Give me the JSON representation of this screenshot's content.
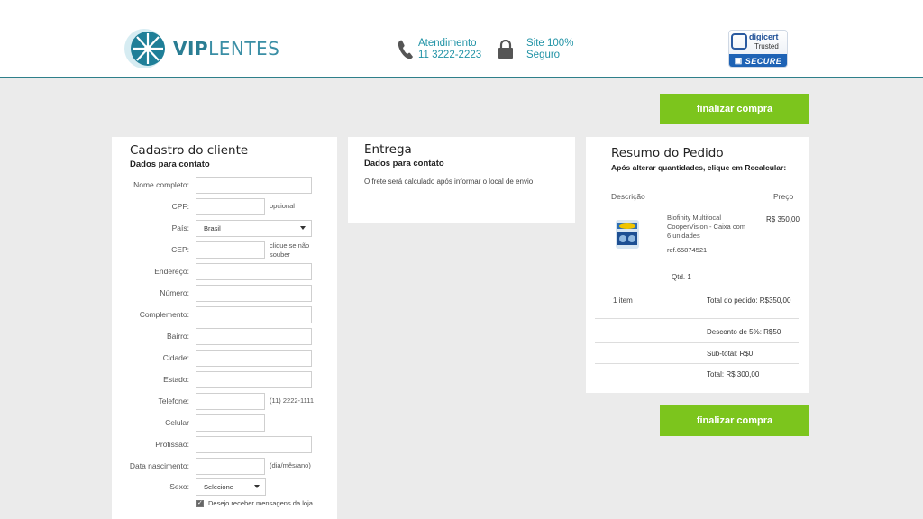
{
  "header": {
    "logo": {
      "vip": "VIP",
      "lentes": "LENTES"
    },
    "contact": {
      "label": "Atendimento",
      "phone": "11 3222-2223",
      "icon": "phone-icon"
    },
    "secure": {
      "line1": "Site 100%",
      "line2": "Seguro",
      "icon": "lock-icon"
    },
    "digicert": {
      "brand": "digicert",
      "trusted": "Trusted",
      "secure": "SECURE"
    }
  },
  "buttons": {
    "finalizar_top": "finalizar compra",
    "finalizar_bottom": "finalizar compra"
  },
  "cadastro": {
    "title": "Cadastro do cliente",
    "subtitle": "Dados para contato",
    "fields": [
      {
        "label": "Nome completo:",
        "value": "",
        "hint": ""
      },
      {
        "label": "CPF:",
        "value": "",
        "hint": "opcional"
      },
      {
        "label": "País:",
        "value": "Brasil",
        "hint": ""
      },
      {
        "label": "CEP:",
        "value": "",
        "hint": "clique se não souber"
      },
      {
        "label": "Endereço:",
        "value": "",
        "hint": ""
      },
      {
        "label": "Número:",
        "value": "",
        "hint": ""
      },
      {
        "label": "Complemento:",
        "value": "",
        "hint": ""
      },
      {
        "label": "Bairro:",
        "value": "",
        "hint": ""
      },
      {
        "label": "Cidade:",
        "value": "",
        "hint": ""
      },
      {
        "label": "Estado:",
        "value": "",
        "hint": ""
      },
      {
        "label": "Telefone:",
        "value": "",
        "hint": "(11) 2222-1111"
      },
      {
        "label": "Celular",
        "value": "",
        "hint": ""
      },
      {
        "label": "Profissão:",
        "value": "",
        "hint": ""
      },
      {
        "label": "Data nascimento:",
        "value": "",
        "hint": "(dia/mês/ano)"
      },
      {
        "label": "Sexo:",
        "value": "Selecione",
        "hint": ""
      }
    ],
    "checkbox_label": "Desejo receber mensagens da loja",
    "checkbox_checked": true
  },
  "entrega": {
    "title": "Entrega",
    "subtitle": "Dados para contato",
    "note": "O frete será calculado após informar o local de envio"
  },
  "resumo": {
    "title": "Resumo do Pedido",
    "subtitle": "Após alterar quantidades, clique em Recalcular:",
    "col_descricao": "Descrição",
    "col_preco": "Preço",
    "product": {
      "name": "Biofinity Multifocal CooperVision - Caixa com 6 unidades",
      "ref": "ref.65874521",
      "price": "R$ 350,00",
      "qty": "Qtd. 1"
    },
    "item_count": "1 item",
    "total_pedido": "Total do pedido: R$350,00",
    "desconto": "Desconto de 5%: R$50",
    "subtotal": "Sub-total: R$0",
    "total": "Total: R$ 300,00"
  }
}
